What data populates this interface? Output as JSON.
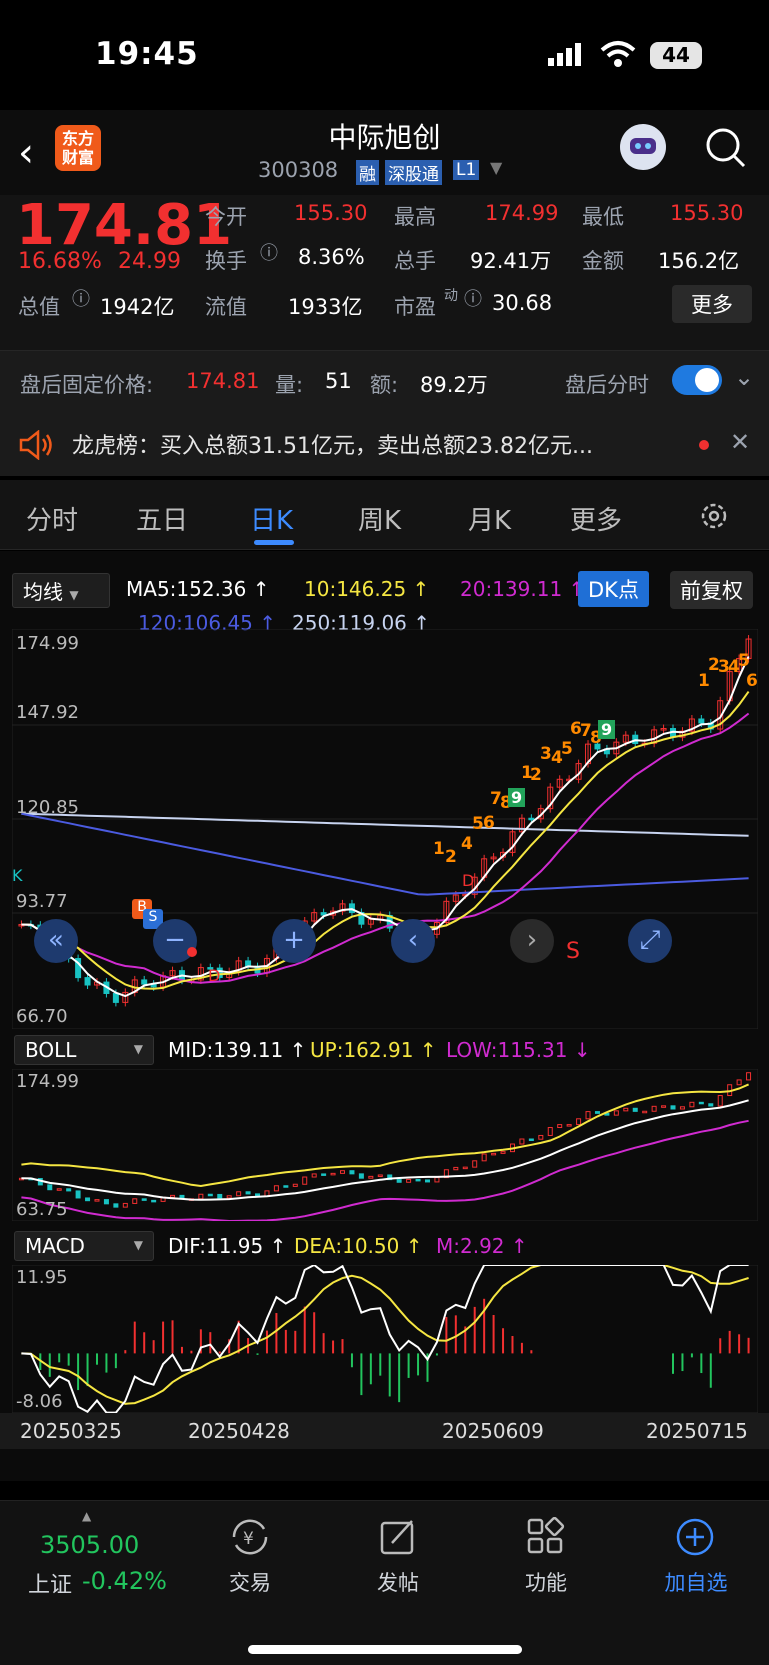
{
  "status_bar": {
    "time": "19:45",
    "battery": "44"
  },
  "header": {
    "logo": "东方\n财富",
    "stock_name": "中际旭创",
    "stock_code": "300308",
    "badges": [
      "融",
      "深股通",
      "L1"
    ]
  },
  "quote": {
    "price": "174.81",
    "change_pct": "16.68%",
    "change": "24.99",
    "open_label": "今开",
    "open": "155.30",
    "high_label": "最高",
    "high": "174.99",
    "low_label": "最低",
    "low": "155.30",
    "turnover_label": "换手",
    "turnover": "8.36%",
    "volume_label": "总手",
    "volume": "92.41万",
    "amount_label": "金额",
    "amount": "156.2亿",
    "mktcap_label": "总值",
    "mktcap": "1942亿",
    "float_label": "流值",
    "float_cap": "1933亿",
    "pe_label": "市盈",
    "pe_sup": "动",
    "pe": "30.68",
    "more": "更多"
  },
  "after_hours": {
    "label": "盘后固定价格:",
    "price": "174.81",
    "vol_label": "量:",
    "vol": "51",
    "amt_label": "额:",
    "amt": "89.2万",
    "toggle_label": "盘后分时",
    "toggle_on": true
  },
  "banner": {
    "text": "龙虎榜：买入总额31.51亿元，卖出总额23.82亿元..."
  },
  "tabs": [
    "分时",
    "五日",
    "日K",
    "周K",
    "月K",
    "更多"
  ],
  "active_tab": "日K",
  "kline": {
    "indicator": "均线",
    "ma5": "MA5:152.36",
    "ma10": "10:146.25",
    "ma20": "20:139.11",
    "ma120": "120:106.45",
    "ma250": "250:119.06",
    "dk_button": "DK点",
    "adjust_button": "前复权",
    "y_labels": [
      "174.99",
      "147.92",
      "120.85",
      "93.77",
      "66.70"
    ],
    "colors": {
      "ma5": "#ffffff",
      "ma10": "#f5e642",
      "ma20": "#d02bd0",
      "ma120": "#4b5be0",
      "ma250": "#c8d4f0",
      "up": "#f23030",
      "down": "#19c3c3"
    }
  },
  "boll": {
    "indicator": "BOLL",
    "mid": "MID:139.11",
    "up": "UP:162.91",
    "low": "LOW:115.31",
    "y_labels": [
      "174.99",
      "63.75"
    ]
  },
  "macd": {
    "indicator": "MACD",
    "dif": "DIF:11.95",
    "dea": "DEA:10.50",
    "m": "M:2.92",
    "y_labels": [
      "11.95",
      "-8.06"
    ]
  },
  "dates": [
    "20250325",
    "20250428",
    "20250609",
    "20250715"
  ],
  "bottom_nav": {
    "index_value": "3505.00",
    "index_name": "上证",
    "index_change": "-0.42%",
    "items": [
      "交易",
      "发帖",
      "功能",
      "加自选"
    ]
  }
}
